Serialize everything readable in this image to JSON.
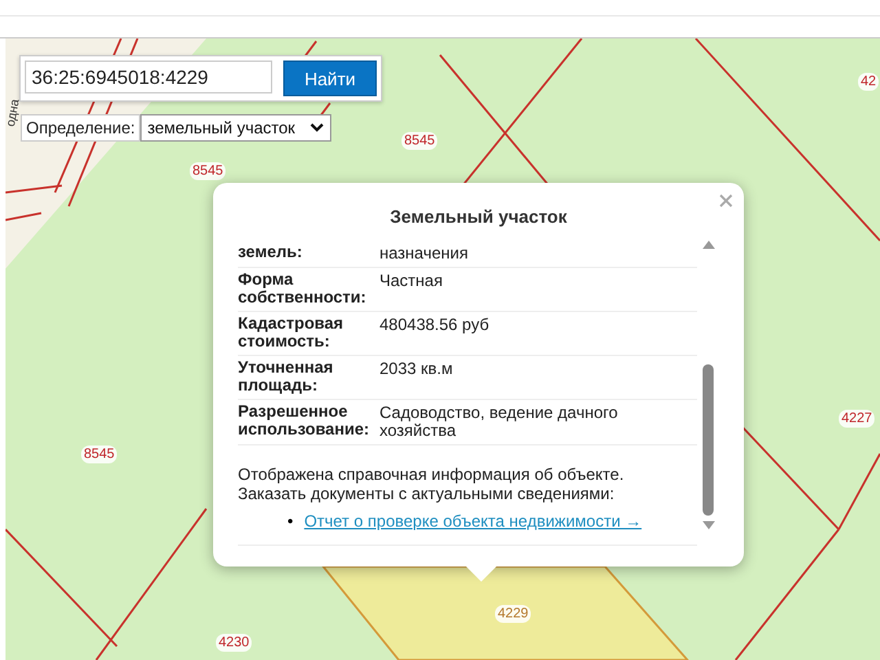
{
  "search": {
    "value": "36:25:6945018:4229",
    "button": "Найти"
  },
  "definition": {
    "label": "Определение:",
    "value": "земельный участок"
  },
  "map_labels": [
    {
      "text": "8545",
      "kind": "parcel"
    },
    {
      "text": "8545",
      "kind": "parcel"
    },
    {
      "text": "8545",
      "kind": "parcel"
    },
    {
      "text": "4227",
      "kind": "parcel"
    },
    {
      "text": "4229",
      "kind": "selected"
    },
    {
      "text": "4230",
      "kind": "parcel"
    },
    {
      "text": "42",
      "kind": "parcel"
    }
  ],
  "road_label": "одна",
  "popup": {
    "title": "Земельный участок",
    "rows": [
      {
        "label": "земель:",
        "value": "назначения"
      },
      {
        "label": "Форма собственности:",
        "value": "Частная"
      },
      {
        "label": "Кадастровая стоимость:",
        "value": "480438.56 руб"
      },
      {
        "label": "Уточненная площадь:",
        "value": "2033 кв.м"
      },
      {
        "label": "Разрешенное использование:",
        "value": "Садоводство, ведение дачного хозяйства"
      }
    ],
    "note_lines": [
      "Отображена справочная информация об объекте.",
      "Заказать документы с актуальными сведениями:"
    ],
    "bullet": "•",
    "links": [
      "Отчет о проверке объекта недвижимости →"
    ]
  }
}
